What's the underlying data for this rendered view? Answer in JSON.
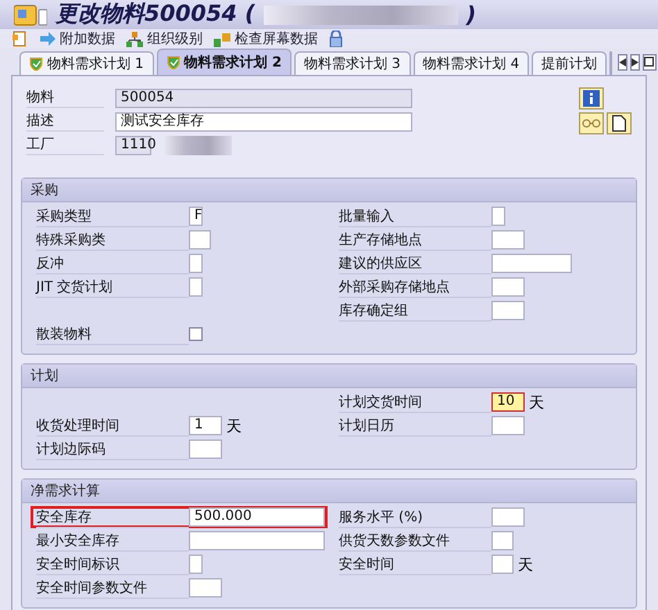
{
  "window": {
    "title": "更改物料500054 (",
    "title_end": ")"
  },
  "toolbar": [
    {
      "kind": "new"
    },
    {
      "kind": "arrow",
      "label": "附加数据"
    },
    {
      "kind": "org",
      "label": "组织级别"
    },
    {
      "kind": "check",
      "label": "检查屏幕数据"
    },
    {
      "kind": "lock"
    }
  ],
  "tabs": [
    {
      "label": "物料需求计划 1",
      "selected": false,
      "status": true
    },
    {
      "label": "物料需求计划 2",
      "selected": true,
      "status": true
    },
    {
      "label": "物料需求计划 3",
      "selected": false,
      "status": false
    },
    {
      "label": "物料需求计划 4",
      "selected": false,
      "status": false
    },
    {
      "label": "提前计划",
      "selected": false,
      "status": false
    }
  ],
  "header": [
    {
      "label": "物料",
      "value": "500054",
      "kind": "readonly-long"
    },
    {
      "label": "描述",
      "value": "测试安全库存",
      "kind": "input-long"
    },
    {
      "label": "工厂",
      "value": "1110",
      "kind": "readonly-short",
      "redacted": true
    }
  ],
  "sections": [
    {
      "title": "采购",
      "rows": [
        {
          "left": {
            "label": "采购类型",
            "value": "F",
            "kind": "char"
          },
          "right": {
            "label": "批量输入",
            "kind": "char"
          }
        },
        {
          "left": {
            "label": "特殊采购类",
            "kind": "short"
          },
          "right": {
            "label": "生产存储地点",
            "kind": "code"
          }
        },
        {
          "left": {
            "label": "反冲",
            "kind": "char"
          },
          "right": {
            "label": "建议的供应区",
            "kind": "wide"
          }
        },
        {
          "left": {
            "label": "JIT 交货计划",
            "kind": "char"
          },
          "right": {
            "label": "外部采购存储地点",
            "kind": "code"
          }
        },
        {
          "right": {
            "label": "库存确定组",
            "kind": "code"
          }
        },
        {
          "left": {
            "label": "散装物料",
            "kind": "check",
            "checked": false
          }
        }
      ]
    },
    {
      "title": "计划",
      "rows": [
        {
          "right": {
            "label": "计划交货时间",
            "value": "10",
            "kind": "code",
            "unit": "天",
            "focused": true
          }
        },
        {
          "left": {
            "label": "收货处理时间",
            "value": "1",
            "kind": "code",
            "unit": "天"
          },
          "right": {
            "label": "计划日历",
            "kind": "code"
          }
        },
        {
          "left": {
            "label": "计划边际码",
            "kind": "code"
          }
        }
      ]
    },
    {
      "title": "净需求计算",
      "rows": [
        {
          "left": {
            "label": "安全库存",
            "value": "500.000",
            "kind": "number",
            "highlighted": true
          },
          "right": {
            "label": "服务水平 (%)",
            "kind": "code"
          }
        },
        {
          "left": {
            "label": "最小安全库存",
            "kind": "number"
          },
          "right": {
            "label": "供货天数参数文件",
            "kind": "short"
          }
        },
        {
          "left": {
            "label": "安全时间标识",
            "kind": "char"
          },
          "right": {
            "label": "安全时间",
            "kind": "short",
            "unit": "天"
          }
        },
        {
          "left": {
            "label": "安全时间参数文件",
            "kind": "code"
          }
        }
      ]
    }
  ]
}
